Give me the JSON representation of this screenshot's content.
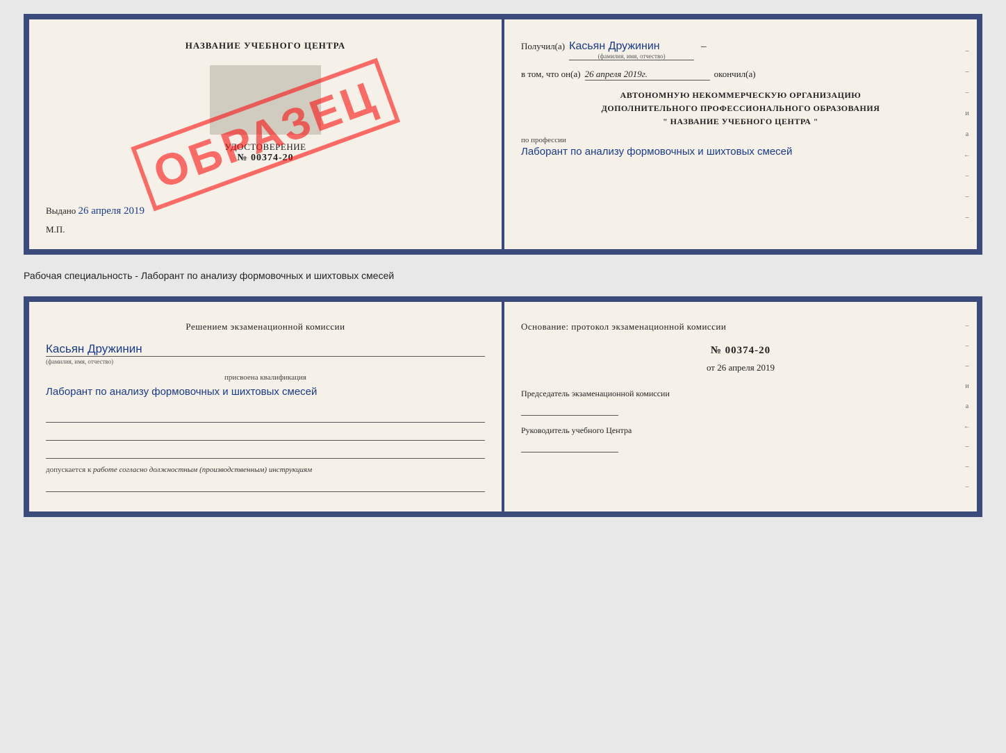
{
  "top_doc": {
    "left": {
      "title": "НАЗВАНИЕ УЧЕБНОГО ЦЕНТРА",
      "id_placeholder": "",
      "doc_label": "УДОСТОВЕРЕНИЕ",
      "doc_number": "№ 00374-20",
      "issued_label": "Выдано",
      "issued_date": "26 апреля 2019",
      "mp_label": "М.П.",
      "stamp_text": "ОБРАЗЕЦ"
    },
    "right": {
      "received_label": "Получил(а)",
      "received_name": "Касьян Дружинин",
      "name_subtext": "(фамилия, имя, отчество)",
      "date_label": "в том, что он(а)",
      "date_value": "26 апреля 2019г.",
      "finished_label": "окончил(а)",
      "org_line1": "АВТОНОМНУЮ НЕКОММЕРЧЕСКУЮ ОРГАНИЗАЦИЮ",
      "org_line2": "ДОПОЛНИТЕЛЬНОГО ПРОФЕССИОНАЛЬНОГО ОБРАЗОВАНИЯ",
      "org_line3": "\"  НАЗВАНИЕ УЧЕБНОГО ЦЕНТРА  \"",
      "profession_label": "по профессии",
      "profession_text": "Лаборант по анализу формовочных и шихтовых смесей",
      "right_marks": [
        "–",
        "–",
        "–",
        "и",
        "а",
        "←",
        "–",
        "–",
        "–"
      ]
    }
  },
  "separator": {
    "text": "Рабочая специальность - Лаборант по анализу формовочных и шихтовых смесей"
  },
  "bottom_doc": {
    "left": {
      "section_title": "Решением экзаменационной комиссии",
      "person_name": "Касьян Дружинин",
      "name_subtext": "(фамилия, имя, отчество)",
      "qual_label": "присвоена квалификация",
      "qual_text": "Лаборант по анализу формовочных и шихтовых смесей",
      "dopusk_label": "допускается к",
      "dopusk_text": "работе согласно должностным (производственным) инструкциям"
    },
    "right": {
      "osnov_title": "Основание: протокол экзаменационной комиссии",
      "protocol_number": "№ 00374-20",
      "date_prefix": "от",
      "protocol_date": "26 апреля 2019",
      "chairman_label": "Председатель экзаменационной комиссии",
      "head_label": "Руководитель учебного Центра",
      "right_marks": [
        "–",
        "–",
        "–",
        "и",
        "а",
        "←",
        "–",
        "–",
        "–"
      ]
    }
  }
}
